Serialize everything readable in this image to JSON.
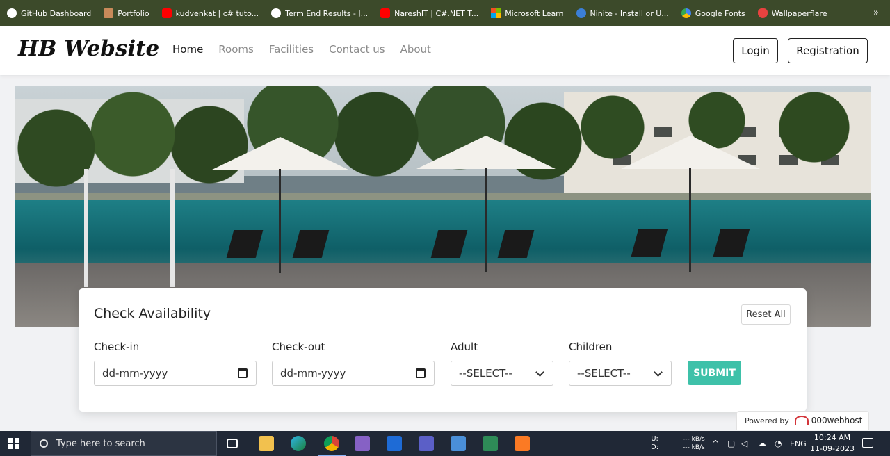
{
  "bookmarks": {
    "items": [
      {
        "label": "GitHub Dashboard",
        "icon": "github-icon",
        "color": "#ffffff"
      },
      {
        "label": "Portfolio",
        "icon": "portfolio-icon",
        "color": "#c98a5a"
      },
      {
        "label": "kudvenkat | c# tuto...",
        "icon": "youtube-icon",
        "color": "#ff0000"
      },
      {
        "label": "Term End Results - J...",
        "icon": "globe-icon",
        "color": "#ffffff"
      },
      {
        "label": "NareshIT | C#.NET T...",
        "icon": "youtube-icon",
        "color": "#ff0000"
      },
      {
        "label": "Microsoft Learn",
        "icon": "microsoft-icon",
        "color": "#f25022"
      },
      {
        "label": "Ninite - Install or U...",
        "icon": "ninite-icon",
        "color": "#3b7fd8"
      },
      {
        "label": "Google Fonts",
        "icon": "google-fonts-icon",
        "color": "#4285f4"
      },
      {
        "label": "Wallpaperflare",
        "icon": "wallpaperflare-icon",
        "color": "#e8423f"
      }
    ],
    "overflow": "»"
  },
  "navbar": {
    "brand": "HB Website",
    "links": [
      "Home",
      "Rooms",
      "Facilities",
      "Contact us",
      "About"
    ],
    "active_link": "Home",
    "login_label": "Login",
    "registration_label": "Registration"
  },
  "availability": {
    "title": "Check Availability",
    "reset_label": "Reset All",
    "checkin_label": "Check-in",
    "checkin_value": "dd-mm-yyyy",
    "checkout_label": "Check-out",
    "checkout_value": "dd-mm-yyyy",
    "adult_label": "Adult",
    "adult_value": "--SELECT--",
    "children_label": "Children",
    "children_value": "--SELECT--",
    "submit_label": "SUBMIT",
    "accent": "#3ec1a9"
  },
  "powered": {
    "prefix": "Powered by",
    "brand": "000webhost"
  },
  "taskbar": {
    "search_placeholder": "Type here to search",
    "net_up_label": "U:",
    "net_down_label": "D:",
    "net_up_value": "--- kB/s",
    "net_down_value": "--- kB/s",
    "language": "ENG",
    "time": "10:24 AM",
    "date": "11-09-2023"
  }
}
